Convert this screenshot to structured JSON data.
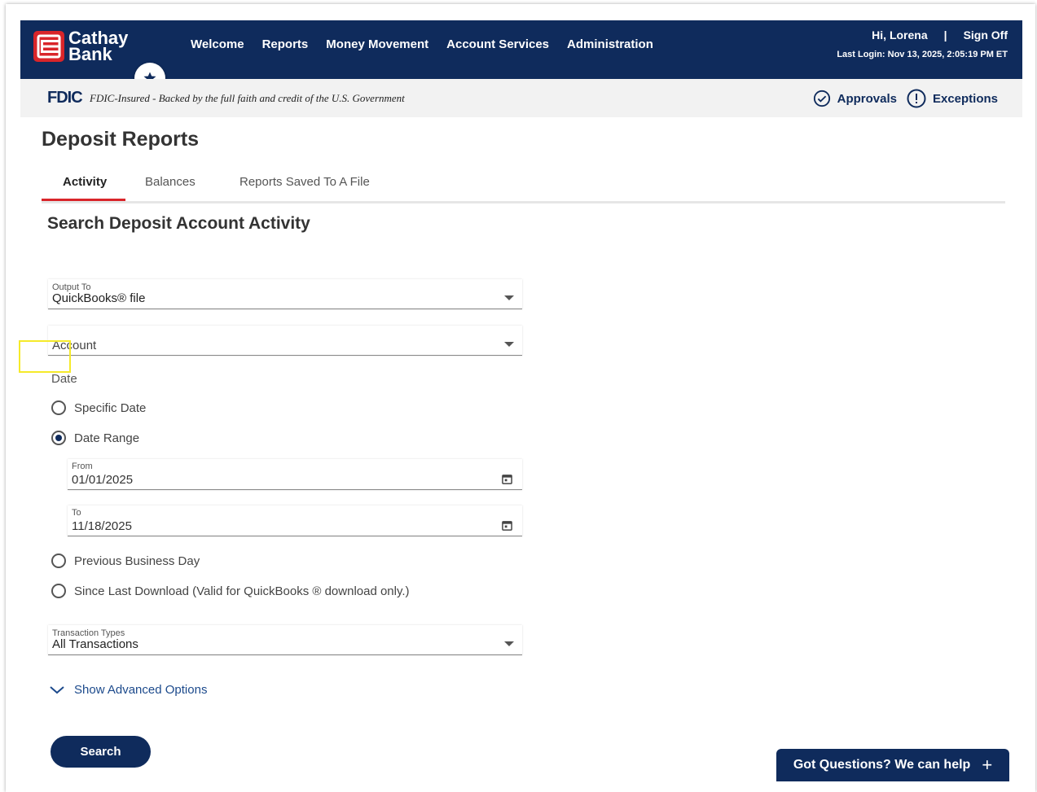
{
  "header": {
    "logo_line1": "Cathay",
    "logo_line2": "Bank",
    "nav": [
      "Welcome",
      "Reports",
      "Money Movement",
      "Account Services",
      "Administration"
    ],
    "greeting": "Hi, Lorena",
    "separator": "|",
    "sign_off": "Sign Off",
    "last_login": "Last Login: Nov 13, 2025, 2:05:19 PM ET"
  },
  "fdic": {
    "logo": "FDIC",
    "text": "FDIC-Insured - Backed by the full faith and credit of the U.S. Government",
    "approvals": "Approvals",
    "exceptions": "Exceptions"
  },
  "page": {
    "title": "Deposit Reports",
    "tabs": [
      "Activity",
      "Balances",
      "Reports Saved To A File"
    ],
    "section_title": "Search Deposit Account Activity"
  },
  "form": {
    "output_label": "Output To",
    "output_value": "QuickBooks® file",
    "account_placeholder": "Account",
    "date_label": "Date",
    "radio_specific": "Specific Date",
    "radio_range": "Date Range",
    "from_label": "From",
    "from_value": "01/01/2025",
    "to_label": "To",
    "to_value": "11/18/2025",
    "radio_prev": "Previous Business Day",
    "radio_since": "Since Last Download (Valid for QuickBooks ® download only.)",
    "txn_label": "Transaction Types",
    "txn_value": "All Transactions",
    "advanced": "Show Advanced Options",
    "search": "Search"
  },
  "help": {
    "label": "Got Questions? We can help",
    "plus": "+"
  },
  "colors": {
    "navy": "#0f2b5c",
    "red": "#d9252a",
    "highlight": "#f5ea2a"
  }
}
